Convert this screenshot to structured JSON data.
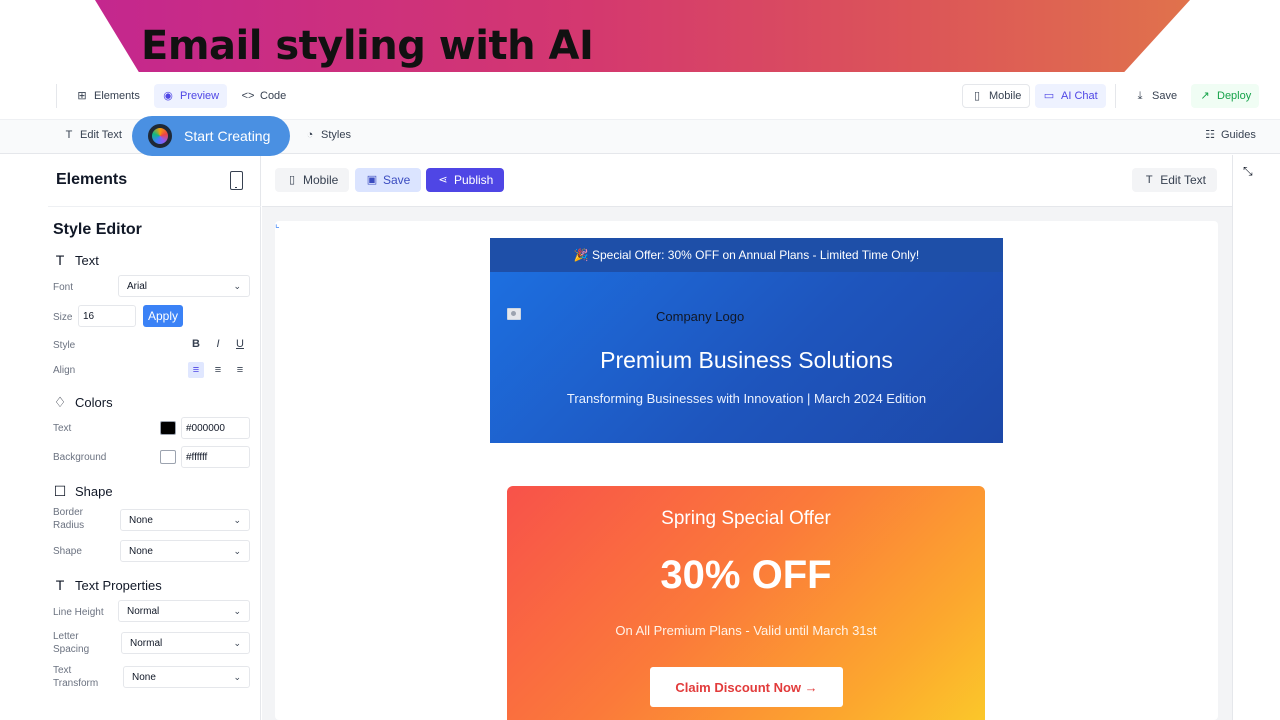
{
  "banner": {
    "title": "Email styling with AI"
  },
  "topbar": {
    "elements": "Elements",
    "preview": "Preview",
    "code": "Code",
    "mobile": "Mobile",
    "ai_chat": "AI Chat",
    "save": "Save",
    "deploy": "Deploy"
  },
  "secbar": {
    "edit_text": "Edit Text",
    "start_creating": "Start Creating",
    "styles": "Styles",
    "guides": "Guides"
  },
  "sidebar": {
    "title": "Elements",
    "style_editor": "Style Editor",
    "text_section": "Text",
    "font_label": "Font",
    "font_value": "Arial",
    "size_label": "Size",
    "size_value": "16",
    "apply": "Apply",
    "style_label": "Style",
    "align_label": "Align",
    "colors_section": "Colors",
    "text_color_label": "Text",
    "text_color_value": "#000000",
    "bg_color_label": "Background",
    "bg_color_value": "#ffffff",
    "shape_section": "Shape",
    "border_radius_label1": "Border",
    "border_radius_label2": "Radius",
    "border_radius_value": "None",
    "shape_label": "Shape",
    "shape_value": "None",
    "text_props_section": "Text Properties",
    "line_height_label": "Line Height",
    "line_height_value": "Normal",
    "letter_spacing_label1": "Letter",
    "letter_spacing_label2": "Spacing",
    "letter_spacing_value": "Normal",
    "text_transform_label1": "Text",
    "text_transform_label2": "Transform",
    "text_transform_value": "None"
  },
  "editor": {
    "mobile": "Mobile",
    "save": "Save",
    "publish": "Publish",
    "edit_text": "Edit Text"
  },
  "email": {
    "promo": "🎉 Special Offer: 30% OFF on Annual Plans - Limited Time Only!",
    "logo_alt": "Company Logo",
    "hero_title": "Premium Business Solutions",
    "hero_sub": "Transforming Businesses with Innovation | March 2024 Edition",
    "offer_title": "Spring Special Offer",
    "offer_big": "30% OFF",
    "offer_sub": "On All Premium Plans - Valid until March 31st",
    "claim_button": "Claim Discount Now →"
  },
  "colors": {
    "accent": "#4f46e5",
    "hero_blue": "#1e55bd",
    "promo_bar": "#1e4fa8",
    "offer_start": "#f8524a",
    "offer_end": "#fbc72a",
    "start_pill": "#4a90e2"
  }
}
